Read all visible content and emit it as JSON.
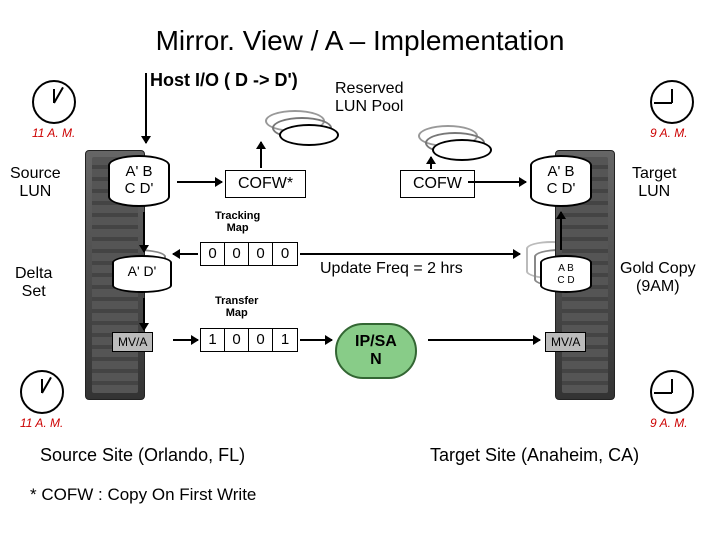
{
  "title": "Mirror. View / A – Implementation",
  "host_io": "Host I/O ( D -> D')",
  "reserved_pool": "Reserved\nLUN Pool",
  "cofw_star": "COFW*",
  "cofw": "COFW",
  "tracking_map_label": "Tracking\nMap",
  "transfer_map_label": "Transfer\nMap",
  "tracking_bits": [
    "0",
    "0",
    "0",
    "0"
  ],
  "transfer_bits": [
    "1",
    "0",
    "0",
    "1"
  ],
  "update_freq": "Update Freq = 2 hrs",
  "ipsan": "IP/SA\nN",
  "source_lun_label": "Source\nLUN",
  "delta_set_label": "Delta\nSet",
  "target_lun_label": "Target\nLUN",
  "gold_copy_label": "Gold Copy\n(9AM)",
  "mv_a": "MV/A",
  "source_cyl": "A' B\n C D'",
  "delta_cyl": "A'  D'",
  "target_cyl": "A' B\nC D'",
  "gold_cyl": "A B\nC D",
  "clock_11": "11 A. M.",
  "clock_9": "9 A. M.",
  "source_site": "Source Site (Orlando, FL)",
  "target_site": "Target Site (Anaheim, CA)",
  "footnote": "* COFW : Copy On First Write"
}
